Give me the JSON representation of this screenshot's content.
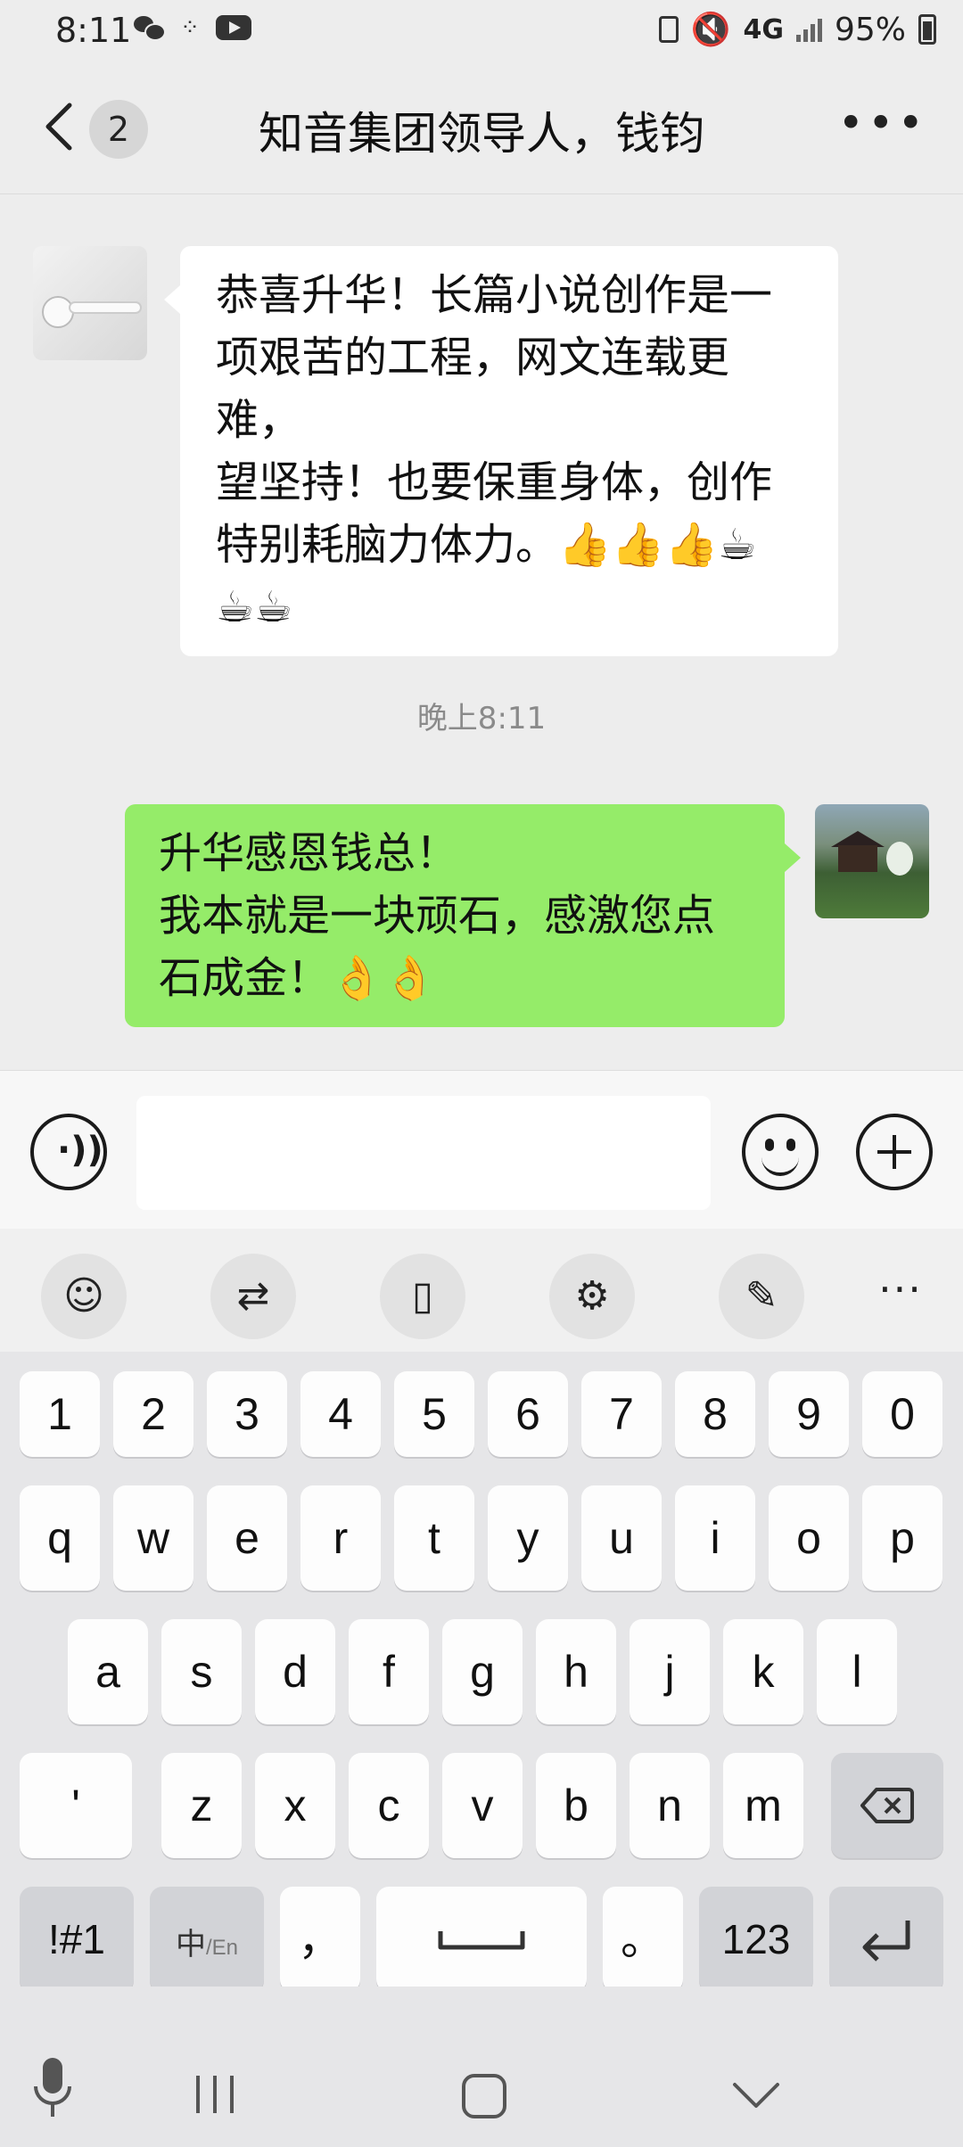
{
  "status_bar": {
    "time": "8:11",
    "network": "4G",
    "battery": "95%"
  },
  "header": {
    "back_icon": "chevron-left",
    "unread_count": "2",
    "title": "知音集团领导人，钱钧",
    "more_icon": "more-horizontal"
  },
  "messages": [
    {
      "side": "left",
      "text_lines": [
        "恭喜升华！长篇小说创作是一",
        "项艰苦的工程，网文连载更难，",
        "望坚持！也要保重身体，创作",
        "特别耗脑力体力。👍👍👍☕",
        "☕☕"
      ]
    },
    {
      "side": "right",
      "text_lines": [
        "升华感恩钱总！",
        "我本就是一块顽石，感激您点",
        "石成金！👌👌"
      ]
    }
  ],
  "timestamp": "晚上8:11",
  "input_bar": {
    "voice_icon": "voice-icon",
    "message_value": "",
    "emoji_icon": "emoji-icon",
    "plus_icon": "plus-icon"
  },
  "keyboard_toolbar": {
    "tools": [
      "emoji",
      "translate",
      "clipboard",
      "settings",
      "handwriting"
    ],
    "more": "···"
  },
  "keyboard": {
    "row_numbers": [
      "1",
      "2",
      "3",
      "4",
      "5",
      "6",
      "7",
      "8",
      "9",
      "0"
    ],
    "row_1": [
      "q",
      "w",
      "e",
      "r",
      "t",
      "y",
      "u",
      "i",
      "o",
      "p"
    ],
    "row_2": [
      "a",
      "s",
      "d",
      "f",
      "g",
      "h",
      "j",
      "k",
      "l"
    ],
    "row_3": [
      "'",
      "z",
      "x",
      "c",
      "v",
      "b",
      "n",
      "m"
    ],
    "symbols": "!#1",
    "lang_main": "中",
    "lang_alt": "/En",
    "comma": "，",
    "period": "。",
    "numbers": "123"
  },
  "colors": {
    "my_bubble": "#95ec69",
    "their_bubble": "#ffffff",
    "background": "#ededed"
  }
}
